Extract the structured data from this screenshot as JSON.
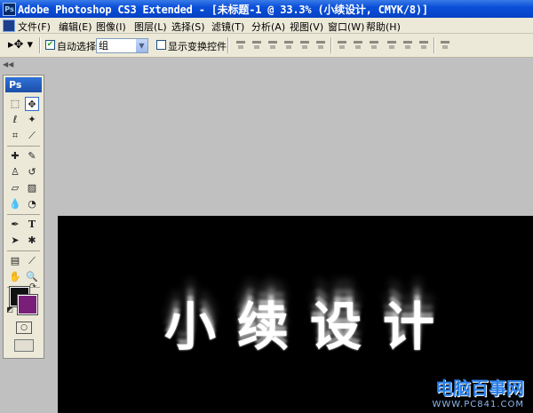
{
  "window": {
    "title": "Adobe Photoshop CS3 Extended - [未标题-1 @ 33.3% (小续设计, CMYK/8)]",
    "app_icon": "Ps"
  },
  "menu": [
    "文件(F)",
    "编辑(E)",
    "图像(I)",
    "图层(L)",
    "选择(S)",
    "滤镜(T)",
    "分析(A)",
    "视图(V)",
    "窗口(W)",
    "帮助(H)"
  ],
  "options": {
    "auto_select_label": "自动选择:",
    "auto_select_checked": true,
    "auto_select_value": "组",
    "show_transform_label": "显示变换控件",
    "show_transform_checked": false
  },
  "toolbox": {
    "badge": "Ps",
    "tools": [
      "marquee-tool",
      "move-tool",
      "lasso-tool",
      "magic-wand-tool",
      "crop-tool",
      "slice-tool",
      "healing-brush-tool",
      "brush-tool",
      "clone-stamp-tool",
      "history-brush-tool",
      "eraser-tool",
      "gradient-tool",
      "blur-tool",
      "dodge-tool",
      "pen-tool",
      "type-tool",
      "path-selection-tool",
      "shape-tool",
      "notes-tool",
      "eyedropper-tool",
      "hand-tool",
      "zoom-tool"
    ],
    "foreground_color": "#111111",
    "background_color": "#7a1f78"
  },
  "canvas": {
    "text": "小续设计",
    "background": "#000000"
  },
  "watermark": {
    "main": "电脑百事网",
    "sub": "WWW.PC841.COM"
  }
}
